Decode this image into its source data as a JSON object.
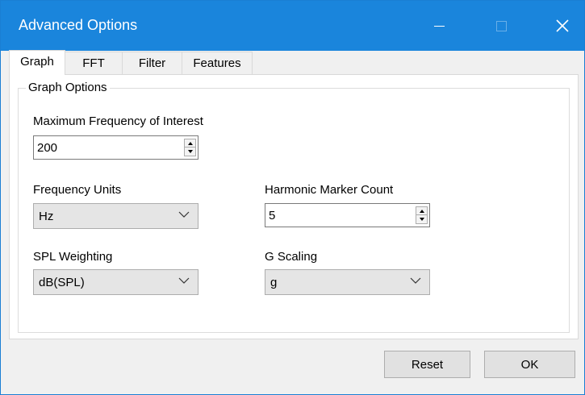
{
  "window": {
    "title": "Advanced Options",
    "accent_color": "#1a85dc"
  },
  "tabs": [
    {
      "label": "Graph",
      "active": true
    },
    {
      "label": "FFT",
      "active": false
    },
    {
      "label": "Filter",
      "active": false
    },
    {
      "label": "Features",
      "active": false
    }
  ],
  "graph_options": {
    "group_title": "Graph Options",
    "max_frequency": {
      "label": "Maximum Frequency of Interest",
      "value": "200"
    },
    "frequency_units": {
      "label": "Frequency Units",
      "value": "Hz"
    },
    "harmonic_marker_count": {
      "label": "Harmonic Marker Count",
      "value": "5"
    },
    "spl_weighting": {
      "label": "SPL Weighting",
      "value": "dB(SPL)"
    },
    "g_scaling": {
      "label": "G Scaling",
      "value": "g"
    }
  },
  "buttons": {
    "reset": "Reset",
    "ok": "OK"
  }
}
